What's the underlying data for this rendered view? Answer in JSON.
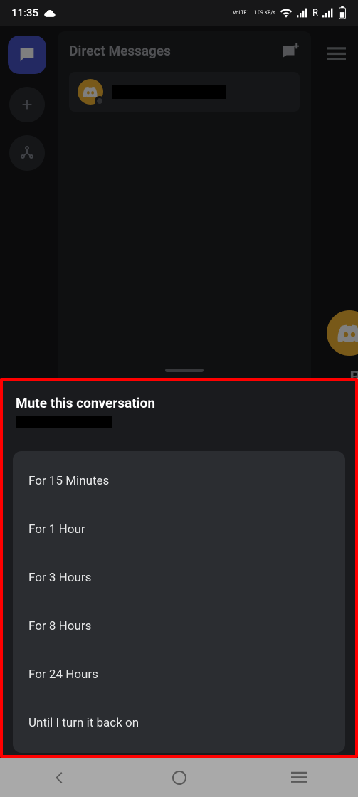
{
  "statusbar": {
    "time": "11:35",
    "lte_label": "VoLTE1",
    "speed": "1.09 KB/s",
    "roaming": "R"
  },
  "app": {
    "dm_title": "Direct Messages",
    "right_partial_label": "Bl"
  },
  "sheet": {
    "title": "Mute this conversation",
    "options": [
      "For 15 Minutes",
      "For 1 Hour",
      "For 3 Hours",
      "For 8 Hours",
      "For 24 Hours",
      "Until I turn it back on"
    ]
  }
}
